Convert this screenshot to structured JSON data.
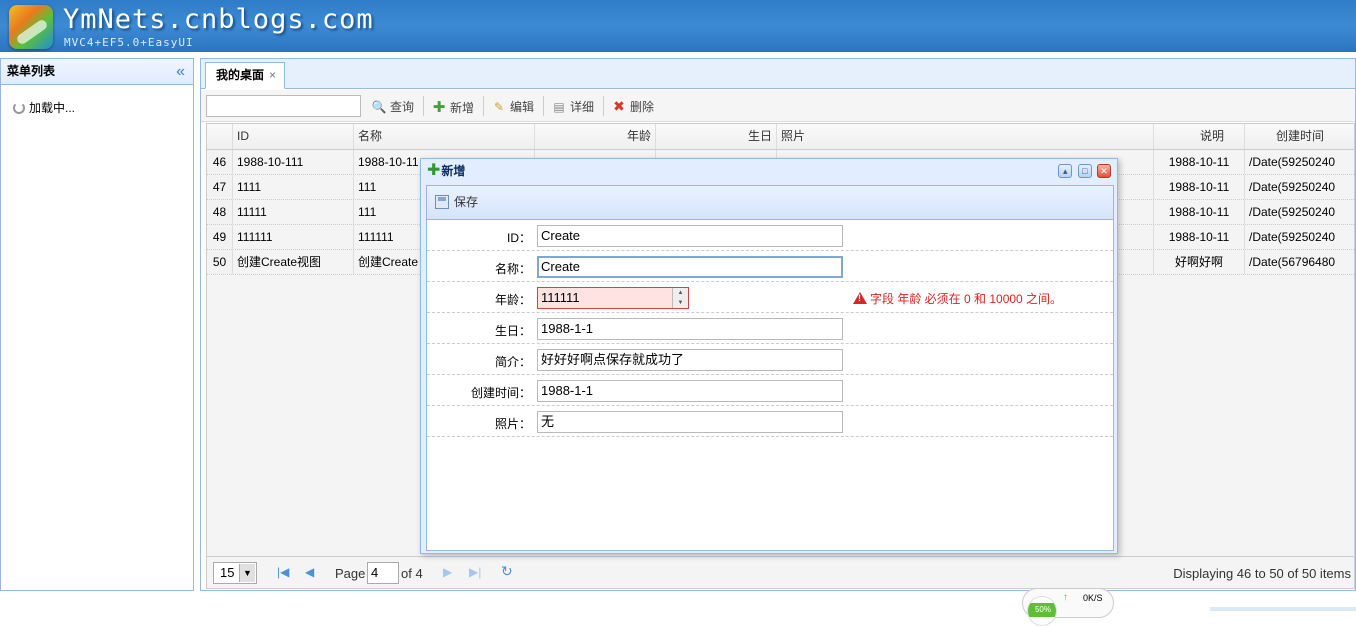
{
  "header": {
    "title": "YmNets.cnblogs.com",
    "subtitle": "MVC4+EF5.0+EasyUI"
  },
  "west": {
    "title": "菜单列表",
    "loading": "加载中..."
  },
  "tabs": [
    {
      "label": "我的桌面"
    }
  ],
  "toolbar": {
    "search": "查询",
    "add": "新增",
    "edit": "编辑",
    "detail": "详细",
    "delete": "删除"
  },
  "grid": {
    "columns": [
      "ID",
      "名称",
      "年龄",
      "生日",
      "照片",
      "说明",
      "创建时间"
    ],
    "rows": [
      {
        "rownum": "46",
        "id": "1988-10-111",
        "name": "1988-10-11",
        "desc": "1988-10-11",
        "created": "/Date(59250240"
      },
      {
        "rownum": "47",
        "id": "1111",
        "name": "111",
        "desc": "1988-10-11",
        "created": "/Date(59250240"
      },
      {
        "rownum": "48",
        "id": "11111",
        "name": "111",
        "desc": "1988-10-11",
        "created": "/Date(59250240"
      },
      {
        "rownum": "49",
        "id": "111111",
        "name": "111111",
        "desc": "1988-10-11",
        "created": "/Date(59250240"
      },
      {
        "rownum": "50",
        "id": "创建Create视图",
        "name": "创建Create",
        "desc": "好啊好啊",
        "created": "/Date(56796480"
      }
    ]
  },
  "pager": {
    "page_size": "15",
    "page_label": "Page",
    "page_value": "4",
    "of_label": "of 4",
    "info": "Displaying 46 to 50 of 50 items"
  },
  "dialog": {
    "title": "新增",
    "save_label": "保存",
    "fields": [
      {
        "label": "ID：",
        "value": "Create"
      },
      {
        "label": "名称：",
        "value": "Create"
      },
      {
        "label": "年龄：",
        "value": "111111",
        "error": "字段 年龄 必须在 0 和 10000 之间。"
      },
      {
        "label": "生日：",
        "value": "1988-1-1"
      },
      {
        "label": "简介：",
        "value": "好好好啊点保存就成功了"
      },
      {
        "label": "创建时间：",
        "value": "1988-1-1"
      },
      {
        "label": "照片：",
        "value": "无"
      }
    ]
  },
  "status": {
    "percent": "50%",
    "speed": "0K/S"
  },
  "colors": {
    "header_blue": "#2f7cc8",
    "border_blue": "#95b8e7",
    "error_red": "#e02020"
  }
}
